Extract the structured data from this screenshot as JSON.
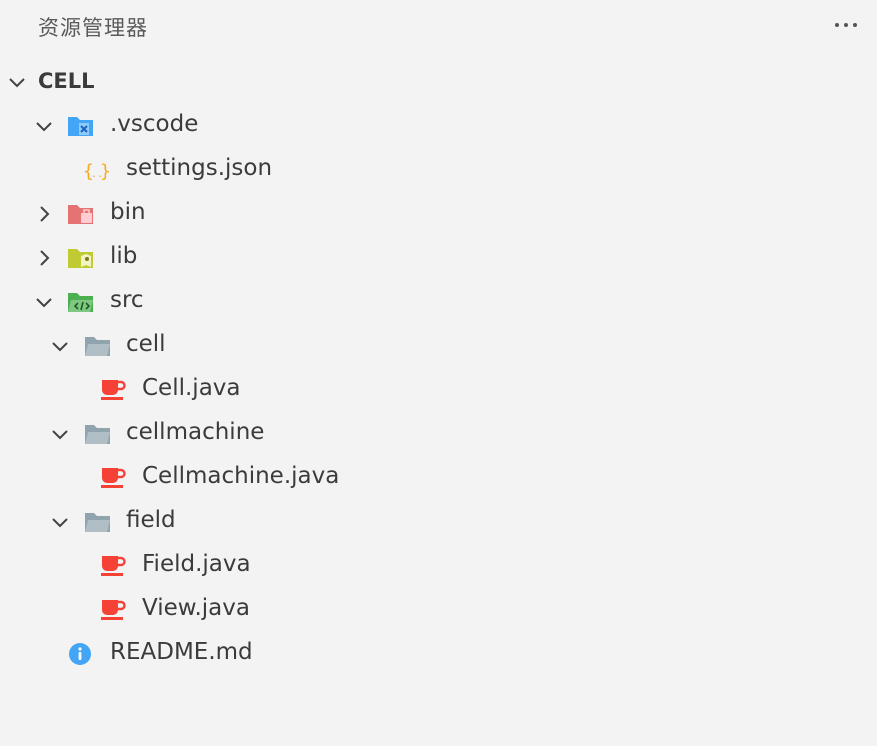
{
  "header": {
    "title": "资源管理器",
    "more_icon": "ellipsis-icon"
  },
  "tree": {
    "root": "CELL",
    "items": [
      {
        "label": ".vscode",
        "icon": "vscode-folder-icon",
        "expanded": true
      },
      {
        "label": "settings.json",
        "icon": "json-icon"
      },
      {
        "label": "bin",
        "icon": "bin-folder-icon",
        "expanded": false
      },
      {
        "label": "lib",
        "icon": "lib-folder-icon",
        "expanded": false
      },
      {
        "label": "src",
        "icon": "src-folder-icon",
        "expanded": true
      },
      {
        "label": "cell",
        "icon": "folder-icon",
        "expanded": true
      },
      {
        "label": "Cell.java",
        "icon": "java-icon"
      },
      {
        "label": "cellmachine",
        "icon": "folder-icon",
        "expanded": true
      },
      {
        "label": "Cellmachine.java",
        "icon": "java-icon"
      },
      {
        "label": "field",
        "icon": "folder-icon",
        "expanded": true
      },
      {
        "label": "Field.java",
        "icon": "java-icon"
      },
      {
        "label": "View.java",
        "icon": "java-icon"
      },
      {
        "label": "README.md",
        "icon": "info-icon"
      }
    ]
  },
  "colors": {
    "background": "#f3f3f3",
    "text": "#3b3b3b",
    "vscode_folder": "#42a5f5",
    "bin_folder": "#e57373",
    "lib_folder": "#c0ca33",
    "src_folder": "#4caf50",
    "plain_folder": "#90a4ae",
    "java": "#f44336",
    "json": "#f9a825",
    "info": "#42a5f5"
  }
}
